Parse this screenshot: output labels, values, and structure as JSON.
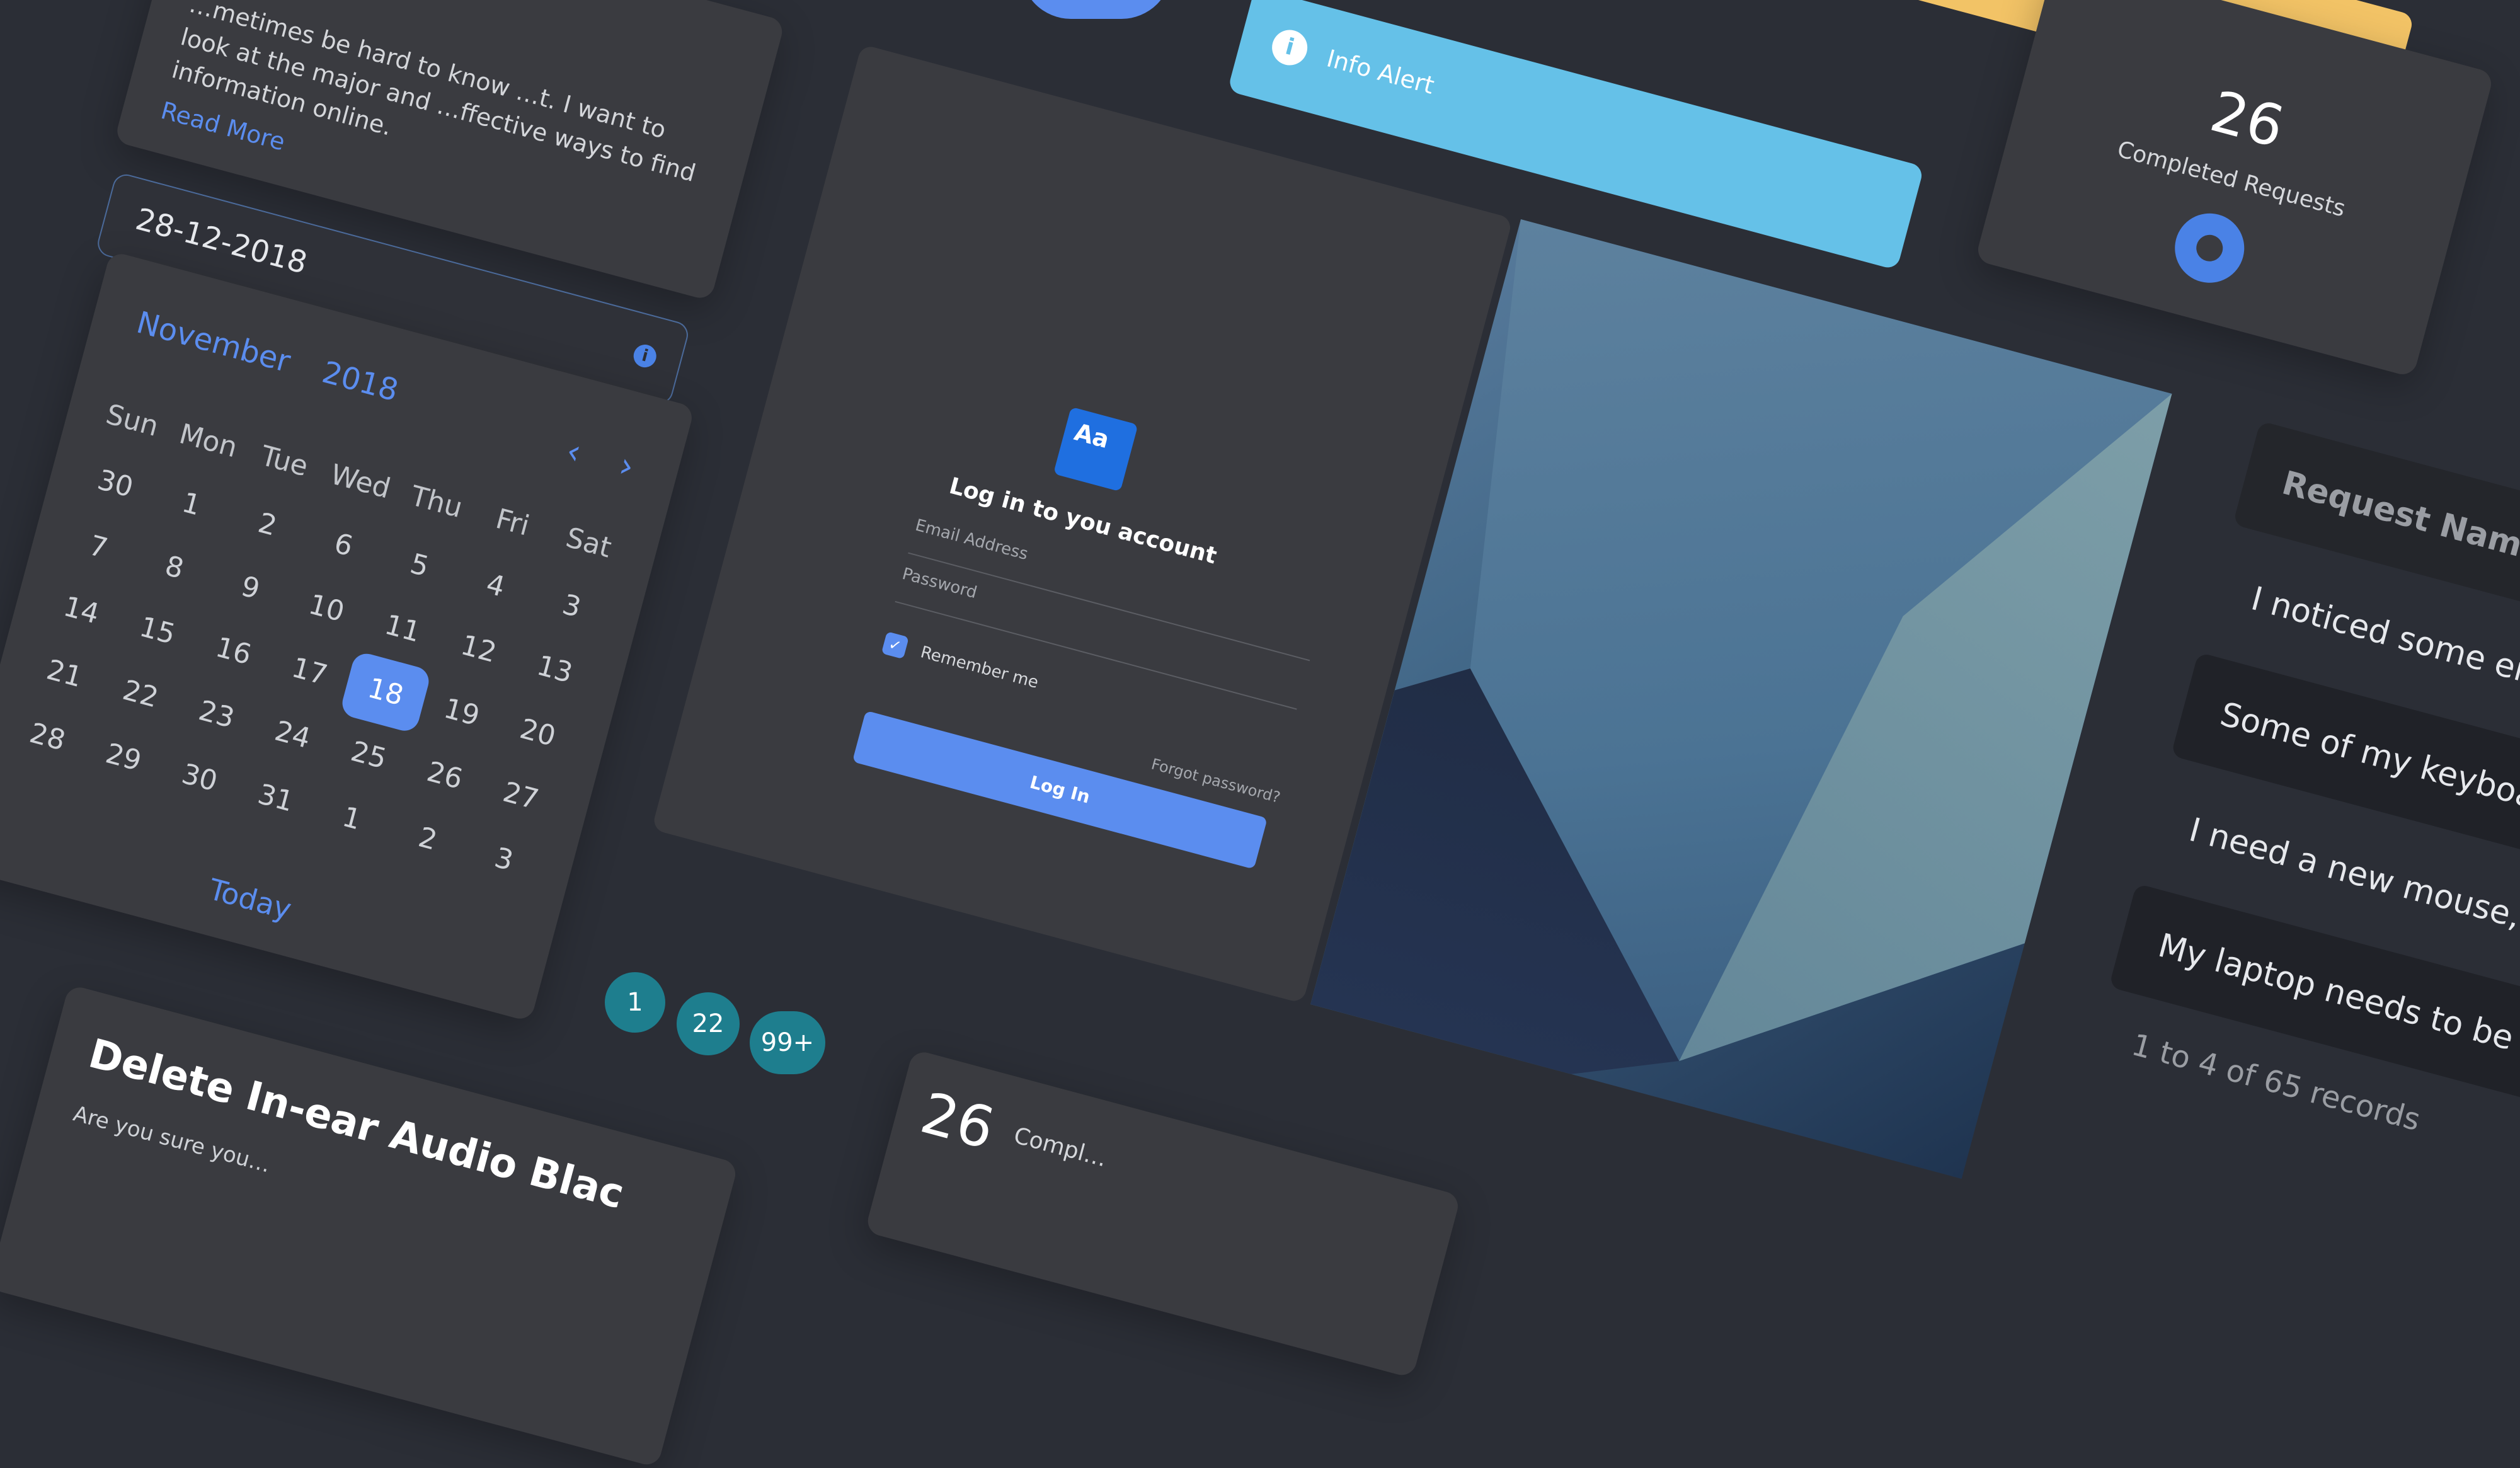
{
  "article_card": {
    "text": "…metimes be hard to know …t. I want to look at the major and …ffective ways to find information online.",
    "read_more": "Read More"
  },
  "date_input": {
    "value": "28-12-2018"
  },
  "calendar": {
    "month": "November",
    "year": "2018",
    "weekdays": [
      "Sun",
      "Mon",
      "Tue",
      "Wed",
      "Thu",
      "Fri",
      "Sat"
    ],
    "weeks": [
      [
        "30",
        "1",
        "2",
        "6",
        "5",
        "4",
        "3"
      ],
      [
        "7",
        "8",
        "9",
        "10",
        "11",
        "12",
        "13"
      ],
      [
        "14",
        "15",
        "16",
        "17",
        "18",
        "19",
        "20"
      ],
      [
        "21",
        "22",
        "23",
        "24",
        "25",
        "26",
        "27"
      ],
      [
        "28",
        "29",
        "30",
        "31",
        "1",
        "2",
        "3"
      ]
    ],
    "selected": "18",
    "today_label": "Today"
  },
  "pagination": {
    "badges": [
      "1",
      "22",
      "99+"
    ]
  },
  "login": {
    "title": "Log in to you account",
    "email_placeholder": "Email Address",
    "password_placeholder": "Password",
    "remember": "Remember me",
    "forgot": "Forgot password?",
    "button": "Log In",
    "logo_text": "Aa"
  },
  "alert": {
    "info": "Info Alert"
  },
  "stat_card": {
    "number": "26",
    "label": "Completed Requests"
  },
  "requests_table": {
    "header": "Request Name",
    "rows": [
      "I noticed some er",
      "Some of my keyboa",
      "I need a new mouse, t",
      "My laptop needs to be re"
    ],
    "footer": "1 to 4 of 65 records"
  },
  "delete_modal": {
    "title": "Delete In-ear Audio Blac",
    "body": "Are you sure you…"
  },
  "stat_card_2": {
    "number": "26",
    "label": "Compl…"
  },
  "colors": {
    "background": "#2b2e36",
    "card": "#3a3b40",
    "primary": "#5b8def",
    "info": "#65c1e8",
    "warning": "#f2c366",
    "badge": "#1e7e8e"
  }
}
